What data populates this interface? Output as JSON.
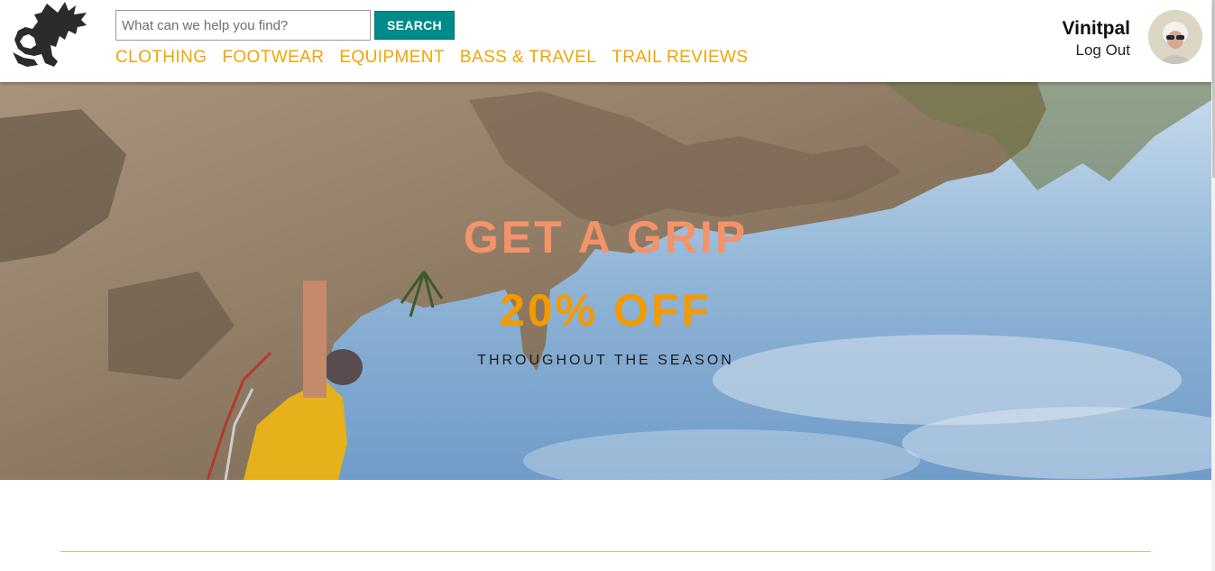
{
  "header": {
    "logo_icon": "dragon-logo-icon",
    "search": {
      "placeholder": "What can we help you find?",
      "value": "",
      "button_label": "SEARCH"
    },
    "nav": [
      {
        "label": "CLOTHING"
      },
      {
        "label": "FOOTWEAR"
      },
      {
        "label": "EQUIPMENT"
      },
      {
        "label": "BASS & TRAVEL"
      },
      {
        "label": "TRAIL REVIEWS"
      }
    ],
    "user": {
      "name": "Vinitpal",
      "logout_label": "Log Out"
    }
  },
  "hero": {
    "headline": "GET A GRIP",
    "discount": "20% OFF",
    "tagline": "THROUGHOUT THE SEASON"
  },
  "colors": {
    "nav": "#f0a500",
    "search_button": "#008b8b",
    "headline": "#f4936a",
    "discount": "#f29a00",
    "divider": "#d8b98a"
  }
}
